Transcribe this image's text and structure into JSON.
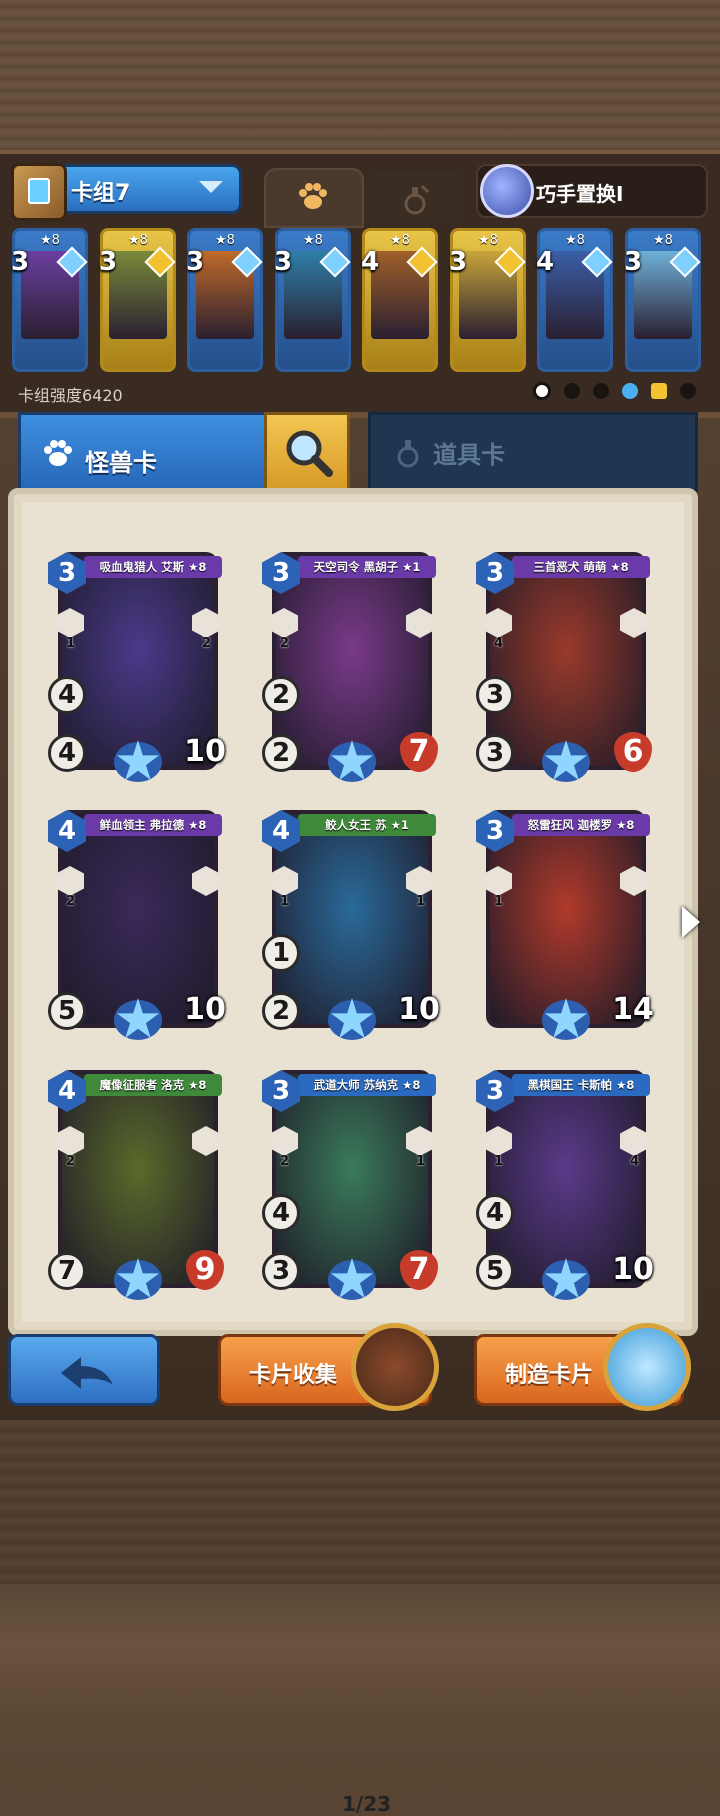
{
  "deck": {
    "name": "卡组7",
    "skill_label": "巧手置换I",
    "power_label": "卡组强度6420",
    "cards": [
      {
        "cost": "3",
        "stars": "★8",
        "gold": false,
        "art": "#6a3fa0"
      },
      {
        "cost": "3",
        "stars": "★8",
        "gold": true,
        "art": "#7a8a3a"
      },
      {
        "cost": "3",
        "stars": "★8",
        "gold": false,
        "art": "#c06a2a"
      },
      {
        "cost": "3",
        "stars": "★8",
        "gold": false,
        "art": "#2e7fa8"
      },
      {
        "cost": "4",
        "stars": "★8",
        "gold": true,
        "art": "#a0602a"
      },
      {
        "cost": "3",
        "stars": "★8",
        "gold": true,
        "art": "#c9a53a"
      },
      {
        "cost": "4",
        "stars": "★8",
        "gold": false,
        "art": "#3a5fa8"
      },
      {
        "cost": "3",
        "stars": "★8",
        "gold": false,
        "art": "#6fb0d8"
      }
    ]
  },
  "tabs": {
    "monster": "怪兽卡",
    "item": "道具卡"
  },
  "cards": [
    {
      "name": "吸血鬼猎人 艾斯 ★8",
      "cost": "3",
      "atk": "4",
      "hp": "10",
      "hex_left": "1",
      "hex_right": "2",
      "extra": "4",
      "banner": "#6a3aa8",
      "frame": "#3a2a6a",
      "art": "#4a3a8a"
    },
    {
      "name": "天空司令 黑胡子 ★1",
      "cost": "3",
      "atk": "2",
      "hp": "7",
      "hex_left": "2",
      "hex_right": "",
      "extra": "2",
      "banner": "#6a3aa8",
      "frame": "#c9a23a",
      "art": "#7a3a8a"
    },
    {
      "name": "三首恶犬 萌萌 ★8",
      "cost": "3",
      "atk": "3",
      "hp": "6",
      "hex_left": "4",
      "hex_right": "",
      "extra": "3",
      "banner": "#6a3aa8",
      "frame": "#3a2a6a",
      "art": "#9a3a2a"
    },
    {
      "name": "鲜血领主 弗拉德 ★8",
      "cost": "4",
      "atk": "5",
      "hp": "10",
      "hex_left": "2",
      "hex_right": "",
      "extra": "",
      "banner": "#6a3aa8",
      "frame": "#3a2a6a",
      "art": "#3a2a5a"
    },
    {
      "name": "鲛人女王 苏 ★1",
      "cost": "4",
      "atk": "2",
      "hp": "10",
      "hex_left": "1",
      "hex_right": "1",
      "extra": "1",
      "banner": "#3f8a3a",
      "frame": "#3a7ac0",
      "art": "#2a6a9a"
    },
    {
      "name": "怒雷狂风 迦楼罗 ★8",
      "cost": "3",
      "atk": "",
      "hp": "14",
      "hex_left": "1",
      "hex_right": "",
      "extra": "",
      "banner": "#6a3aa8",
      "frame": "#a02a2a",
      "art": "#b03a2a"
    },
    {
      "name": "魔像征服者 洛克 ★8",
      "cost": "4",
      "atk": "7",
      "hp": "9",
      "hex_left": "2",
      "hex_right": "",
      "extra": "",
      "banner": "#3f8a3a",
      "frame": "#3a7a3a",
      "art": "#5a6a2a"
    },
    {
      "name": "武道大师 苏纳克 ★8",
      "cost": "3",
      "atk": "3",
      "hp": "7",
      "hex_left": "2",
      "hex_right": "1",
      "extra": "4",
      "banner": "#2a6ac0",
      "frame": "#3a7a3a",
      "art": "#3a7a5a"
    },
    {
      "name": "黑棋国王 卡斯帕 ★8",
      "cost": "3",
      "atk": "5",
      "hp": "10",
      "hex_left": "1",
      "hex_right": "4",
      "extra": "4",
      "banner": "#2a6ac0",
      "frame": "#3a5ab0",
      "art": "#5a3a8a"
    }
  ],
  "pager": "1/23",
  "buttons": {
    "collection": "卡片收集",
    "craft": "制造卡片"
  },
  "colors": {
    "accent_blue": "#2e6fc2",
    "accent_orange": "#e27a2e",
    "parchment": "#e9e2d2"
  }
}
